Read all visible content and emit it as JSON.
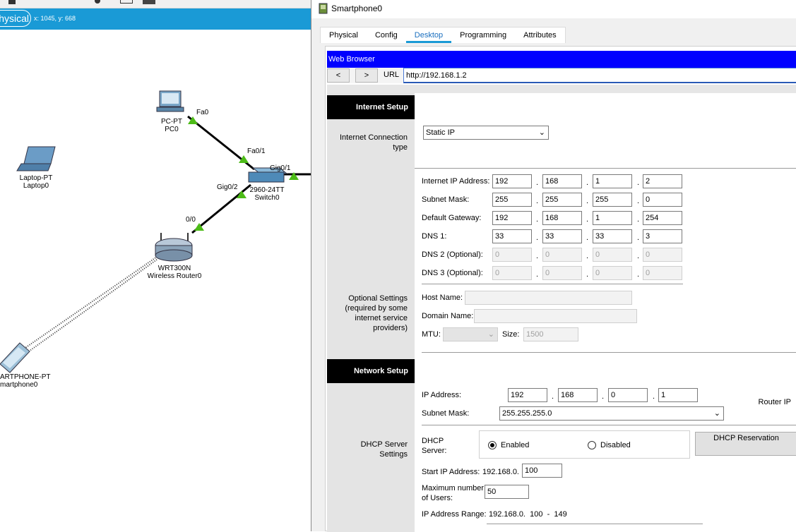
{
  "workspace": {
    "mode_label": "hysical",
    "coords": "x: 1045, y: 668",
    "devices": [
      {
        "type": "PC-PT",
        "name": "PC0"
      },
      {
        "type": "Laptop-PT",
        "name": "Laptop0"
      },
      {
        "type": "2960-24TT",
        "name": "Switch0"
      },
      {
        "type": "WRT300N",
        "name": "Wireless Router0"
      },
      {
        "type": "ARTPHONE-PT",
        "name": "martphone0"
      }
    ],
    "ports": {
      "pc_fa0": "Fa0",
      "sw_fa01": "Fa0/1",
      "sw_gig01": "Gig0/1",
      "sw_gig02": "Gig0/2",
      "router_00": "0/0"
    }
  },
  "window": {
    "title": "Smartphone0",
    "tabs": [
      "Physical",
      "Config",
      "Desktop",
      "Programming",
      "Attributes"
    ],
    "active_tab": "Desktop"
  },
  "browser": {
    "title": "Web Browser",
    "back": "<",
    "forward": ">",
    "url_label": "URL",
    "url": "http://192.168.1.2"
  },
  "internet_setup": {
    "heading": "Internet Setup",
    "conn_type_label": "Internet Connection type",
    "conn_type_value": "Static IP",
    "ip_label": "Internet IP Address:",
    "ip": [
      "192",
      "168",
      "1",
      "2"
    ],
    "mask_label": "Subnet Mask:",
    "mask": [
      "255",
      "255",
      "255",
      "0"
    ],
    "gw_label": "Default Gateway:",
    "gw": [
      "192",
      "168",
      "1",
      "254"
    ],
    "dns1_label": "DNS 1:",
    "dns1": [
      "33",
      "33",
      "33",
      "3"
    ],
    "dns2_label": "DNS 2 (Optional):",
    "dns2": [
      "0",
      "0",
      "0",
      "0"
    ],
    "dns3_label": "DNS 3 (Optional):",
    "dns3": [
      "0",
      "0",
      "0",
      "0"
    ],
    "optional_label": "Optional Settings (required by some internet service providers)",
    "host_label": "Host Name:",
    "domain_label": "Domain Name:",
    "mtu_label": "MTU:",
    "size_label": "Size:",
    "size_value": "1500"
  },
  "network_setup": {
    "heading": "Network Setup",
    "router_ip_label": "Router IP",
    "ip_label": "IP Address:",
    "ip": [
      "192",
      "168",
      "0",
      "1"
    ],
    "mask_label": "Subnet Mask:",
    "mask_value": "255.255.255.0",
    "dhcp_settings_label": "DHCP Server Settings",
    "dhcp_label": "DHCP Server:",
    "enabled_label": "Enabled",
    "disabled_label": "Disabled",
    "dhcp_enabled": true,
    "reservation_label": "DHCP Reservation",
    "start_label": "Start IP Address:",
    "start_prefix": "192.168.0.",
    "start_value": "100",
    "max_label": "Maximum number of Users:",
    "max_value": "50",
    "range_label": "IP Address Range:",
    "range_value": "192.168.0.  100  -  149"
  },
  "colors": {
    "mode_bar": "#1a9ad6",
    "browser_head": "#0000ff",
    "link_green": "#4cbb17"
  }
}
